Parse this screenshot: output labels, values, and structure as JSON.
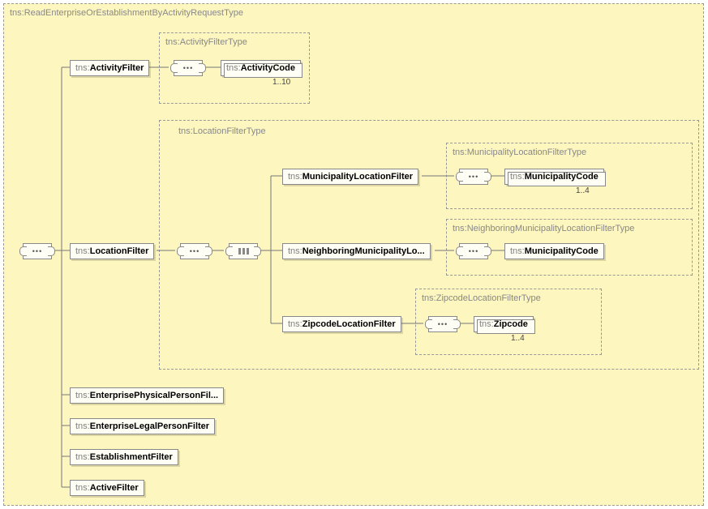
{
  "root": {
    "label": "ReadEnterpriseOrEstablishmentByActivityRequestType",
    "prefix": "tns:"
  },
  "activityFilterType": {
    "label": "ActivityFilterType",
    "prefix": "tns:"
  },
  "activityFilter": {
    "label": "ActivityFilter",
    "prefix": "tns:"
  },
  "activityCode": {
    "label": "ActivityCode",
    "prefix": "tns:",
    "card": "1..10"
  },
  "locationFilterType": {
    "label": "LocationFilterType",
    "prefix": "tns:"
  },
  "locationFilter": {
    "label": "LocationFilter",
    "prefix": "tns:"
  },
  "municipalityLocationFilterType": {
    "label": "MunicipalityLocationFilterType",
    "prefix": "tns:"
  },
  "municipalityLocationFilter": {
    "label": "MunicipalityLocationFilter",
    "prefix": "tns:"
  },
  "municipalityCode": {
    "label": "MunicipalityCode",
    "prefix": "tns:",
    "card": "1..4"
  },
  "neighboringMunicipalityLocationFilterType": {
    "label": "NeighboringMunicipalityLocationFilterType",
    "prefix": "tns:"
  },
  "neighboringMunicipalityLocationFilter": {
    "label": "NeighboringMunicipalityLo...",
    "prefix": "tns:"
  },
  "municipalityCode2": {
    "label": "MunicipalityCode",
    "prefix": "tns:"
  },
  "zipcodeLocationFilterType": {
    "label": "ZipcodeLocationFilterType",
    "prefix": "tns:"
  },
  "zipcodeLocationFilter": {
    "label": "ZipcodeLocationFilter",
    "prefix": "tns:"
  },
  "zipcode": {
    "label": "Zipcode",
    "prefix": "tns:",
    "card": "1..4"
  },
  "enterprisePhysicalPersonFilter": {
    "label": "EnterprisePhysicalPersonFil...",
    "prefix": "tns:"
  },
  "enterpriseLegalPersonFilter": {
    "label": "EnterpriseLegalPersonFilter",
    "prefix": "tns:"
  },
  "establishmentFilter": {
    "label": "EstablishmentFilter",
    "prefix": "tns:"
  },
  "activeFilter": {
    "label": "ActiveFilter",
    "prefix": "tns:"
  }
}
